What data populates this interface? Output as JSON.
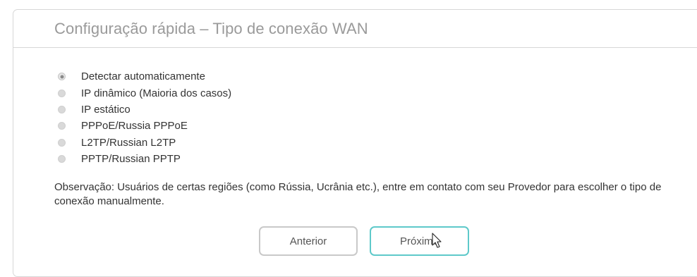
{
  "header": {
    "title": "Configuração rápida – Tipo de conexão WAN"
  },
  "options": [
    {
      "label": "Detectar automaticamente",
      "checked": true
    },
    {
      "label": "IP dinâmico (Maioria dos casos)",
      "checked": false
    },
    {
      "label": "IP estático",
      "checked": false
    },
    {
      "label": "PPPoE/Russia PPPoE",
      "checked": false
    },
    {
      "label": "L2TP/Russian L2TP",
      "checked": false
    },
    {
      "label": "PPTP/Russian PPTP",
      "checked": false
    }
  ],
  "note": "Observação: Usuários de certas regiões (como Rússia, Ucrânia etc.), entre em contato com seu Provedor para escolher o tipo de conexão manualmente.",
  "buttons": {
    "back_label": "Anterior",
    "next_label": "Próximo"
  },
  "colors": {
    "accent": "#5ec9ca",
    "title": "#9a9a9a",
    "border": "#d7d7d7"
  }
}
